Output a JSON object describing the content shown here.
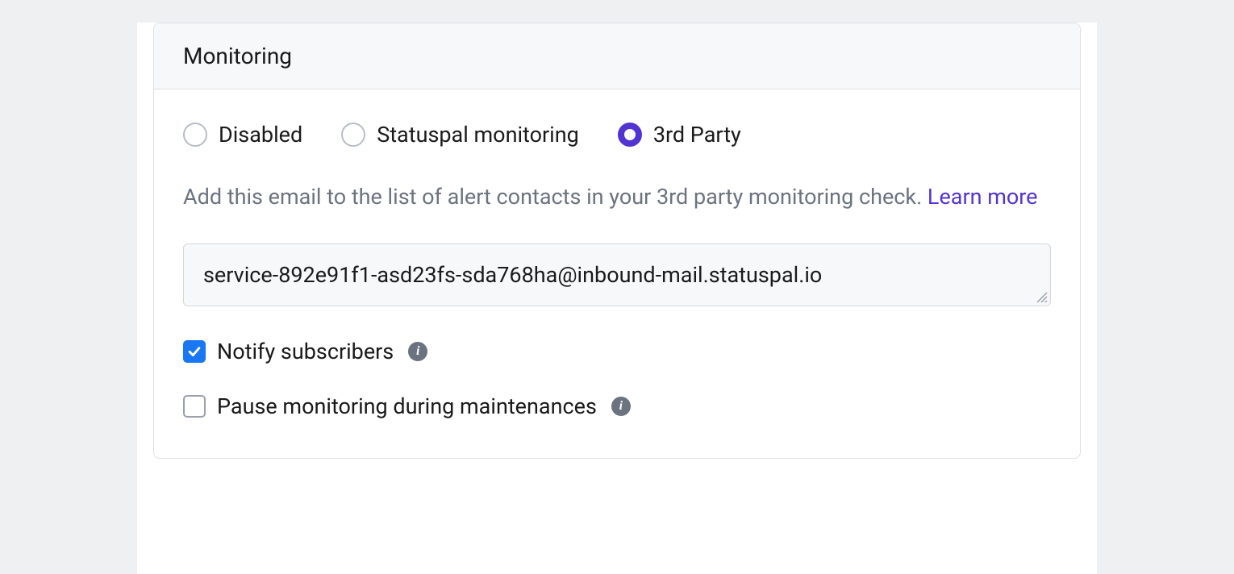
{
  "panel": {
    "title": "Monitoring",
    "radios": {
      "disabled": {
        "label": "Disabled",
        "selected": false
      },
      "statuspal": {
        "label": "Statuspal monitoring",
        "selected": false
      },
      "thirdparty": {
        "label": "3rd Party",
        "selected": true
      }
    },
    "description": "Add this email to the list of alert contacts in your 3rd party monitoring check. ",
    "learn_more": "Learn more",
    "email_value": "service-892e91f1-asd23fs-sda768ha@inbound-mail.statuspal.io",
    "notify": {
      "label": "Notify subscribers",
      "checked": true
    },
    "pause": {
      "label": "Pause monitoring during maintenances",
      "checked": false
    }
  }
}
